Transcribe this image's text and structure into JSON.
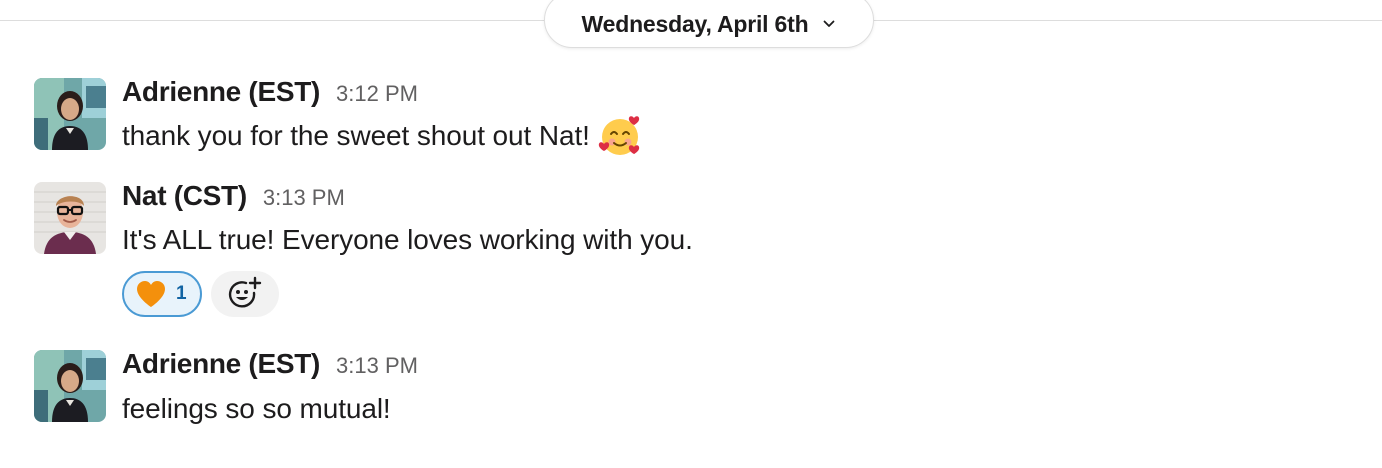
{
  "date_divider": {
    "label": "Wednesday, April 6th",
    "chevron_icon": "chevron-down-icon"
  },
  "messages": [
    {
      "sender": "Adrienne (EST)",
      "time": "3:12 PM",
      "text": "thank you for the sweet shout out Nat!",
      "emoji": "smiling-face-with-hearts",
      "avatar": "adrienne-avatar"
    },
    {
      "sender": "Nat (CST)",
      "time": "3:13 PM",
      "text": "It's ALL true! Everyone loves working with you.",
      "avatar": "nat-avatar",
      "reactions": [
        {
          "emoji": "orange-heart",
          "count": "1",
          "reacted": true
        }
      ],
      "add_reaction_icon": "add-reaction-icon"
    },
    {
      "sender": "Adrienne (EST)",
      "time": "3:13 PM",
      "text": "feelings so so mutual!",
      "avatar": "adrienne-avatar"
    }
  ],
  "colors": {
    "text": "#1d1c1d",
    "timestamp": "#616061",
    "divider": "#dddddd",
    "reaction_border": "#4a9ad4",
    "reaction_bg": "#e8f3fb",
    "reaction_count": "#1264a3",
    "add_reaction_bg": "#f2f2f2"
  }
}
